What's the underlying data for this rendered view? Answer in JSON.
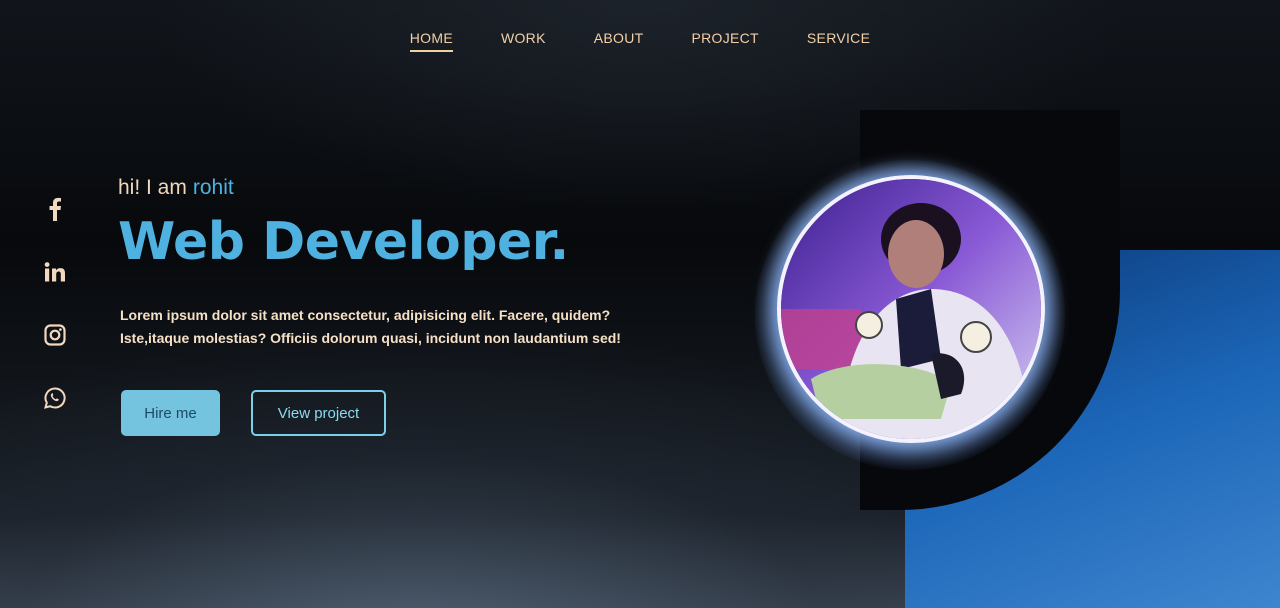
{
  "nav": {
    "items": [
      {
        "label": "HOME",
        "active": true
      },
      {
        "label": "WORK",
        "active": false
      },
      {
        "label": "ABOUT",
        "active": false
      },
      {
        "label": "PROJECT",
        "active": false
      },
      {
        "label": "SERVICE",
        "active": false
      }
    ]
  },
  "social": {
    "icons": [
      "facebook-icon",
      "linkedin-icon",
      "instagram-icon",
      "whatsapp-icon"
    ]
  },
  "hero": {
    "greeting": "hi! I am",
    "name": "rohit",
    "title": "Web Developer.",
    "description": "Lorem ipsum dolor sit amet consectetur, adipisicing elit. Facere, quidem? Iste,itaque molestias? Officiis dolorum quasi, incidunt non laudantium sed!",
    "buttons": {
      "hire": "Hire me",
      "view": "View project"
    }
  },
  "colors": {
    "accent": "#4fb1e0",
    "nav_text": "#f3cfa6",
    "hire_bg": "#74c3df",
    "blue_corner": "#1c66b8"
  },
  "portrait": {
    "icon": "profile-photo"
  }
}
